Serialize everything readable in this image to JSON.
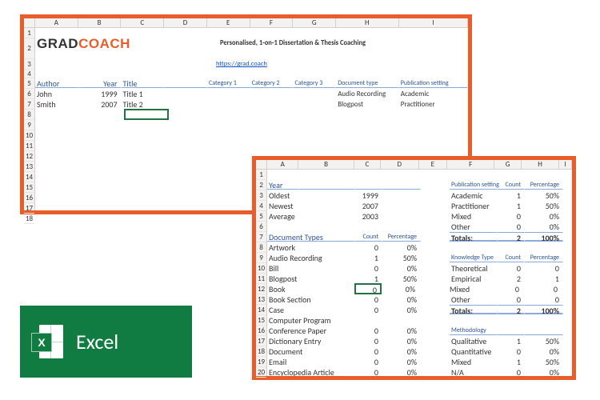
{
  "top": {
    "cols": [
      "A",
      "B",
      "C",
      "D",
      "E",
      "F",
      "G",
      "H",
      "I"
    ],
    "rows": [
      "1",
      "2",
      "3",
      "4",
      "5",
      "6",
      "7",
      "8",
      "9",
      "10",
      "11",
      "12",
      "13",
      "14",
      "15",
      "16",
      "17",
      "18"
    ],
    "logo_grad": "GRAD",
    "logo_coach": "COACH",
    "tagline": "Personalised, 1-on-1 Dissertation & Thesis Coaching",
    "link": "https://grad.coach",
    "headers": {
      "author": "Author",
      "year": "Year",
      "title": "Title",
      "cat1": "Category 1",
      "cat2": "Category 2",
      "cat3": "Category 3",
      "doctype": "Document type",
      "pubset": "Publication setting"
    },
    "data": [
      {
        "author": "John",
        "year": "1999",
        "title": "Title 1",
        "doctype": "Audio Recording",
        "pubset": "Academic"
      },
      {
        "author": "Smith",
        "year": "2007",
        "title": "Title 2",
        "doctype": "Blogpost",
        "pubset": "Practitioner"
      }
    ]
  },
  "bot": {
    "cols": [
      "A",
      "B",
      "C",
      "D",
      "E",
      "F",
      "G",
      "H",
      "I"
    ],
    "rows": [
      "1",
      "2",
      "3",
      "4",
      "5",
      "6",
      "7",
      "8",
      "9",
      "10",
      "11",
      "12",
      "13",
      "14",
      "15",
      "16",
      "17",
      "18",
      "19",
      "20"
    ],
    "year_hdr": "Year",
    "year_rows": [
      [
        "Oldest",
        "1999"
      ],
      [
        "Newest",
        "2007"
      ],
      [
        "Average",
        "2003"
      ]
    ],
    "pubset_hdr": "Publication setting",
    "count": "Count",
    "pct": "Percentage",
    "pubset_rows": [
      [
        "Academic",
        "1",
        "50%"
      ],
      [
        "Practitioner",
        "1",
        "50%"
      ],
      [
        "Mixed",
        "0",
        "0%"
      ],
      [
        "Other",
        "0",
        "0%"
      ]
    ],
    "totals": "Totals:",
    "pubset_tot": [
      "2",
      "100%"
    ],
    "doctype_hdr": "Document Types",
    "doctype_rows": [
      [
        "Artwork",
        "0",
        "0%"
      ],
      [
        "Audio Recording",
        "1",
        "50%"
      ],
      [
        "Bill",
        "0",
        "0%"
      ],
      [
        "Blogpost",
        "1",
        "50%"
      ],
      [
        "Book",
        "0",
        "0%"
      ],
      [
        "Book Section",
        "0",
        "0%"
      ],
      [
        "Case",
        "0",
        "0%"
      ],
      [
        "Computer Program",
        "",
        ""
      ],
      [
        "Conference Paper",
        "0",
        "0%"
      ],
      [
        "Dictionary Entry",
        "0",
        "0%"
      ],
      [
        "Document",
        "0",
        "0%"
      ],
      [
        "Email",
        "0",
        "0%"
      ],
      [
        "Encyclopedia Article",
        "0",
        "0%"
      ]
    ],
    "ktype_hdr": "Knowledge Type",
    "ktype_rows": [
      [
        "Theoretical",
        "0",
        "0"
      ],
      [
        "Empirical",
        "2",
        "1"
      ],
      [
        "Mixed",
        "0",
        "0"
      ],
      [
        "Other",
        "0",
        "0"
      ]
    ],
    "ktype_tot": [
      "2",
      "100%"
    ],
    "meth_hdr": "Methodology",
    "meth_rows": [
      [
        "Qualitative",
        "1",
        "50%"
      ],
      [
        "Quantitative",
        "0",
        "0%"
      ],
      [
        "Mixed",
        "1",
        "50%"
      ],
      [
        "N/A",
        "0",
        "0%"
      ]
    ]
  },
  "excel_label": "Excel",
  "excel_x": "X"
}
